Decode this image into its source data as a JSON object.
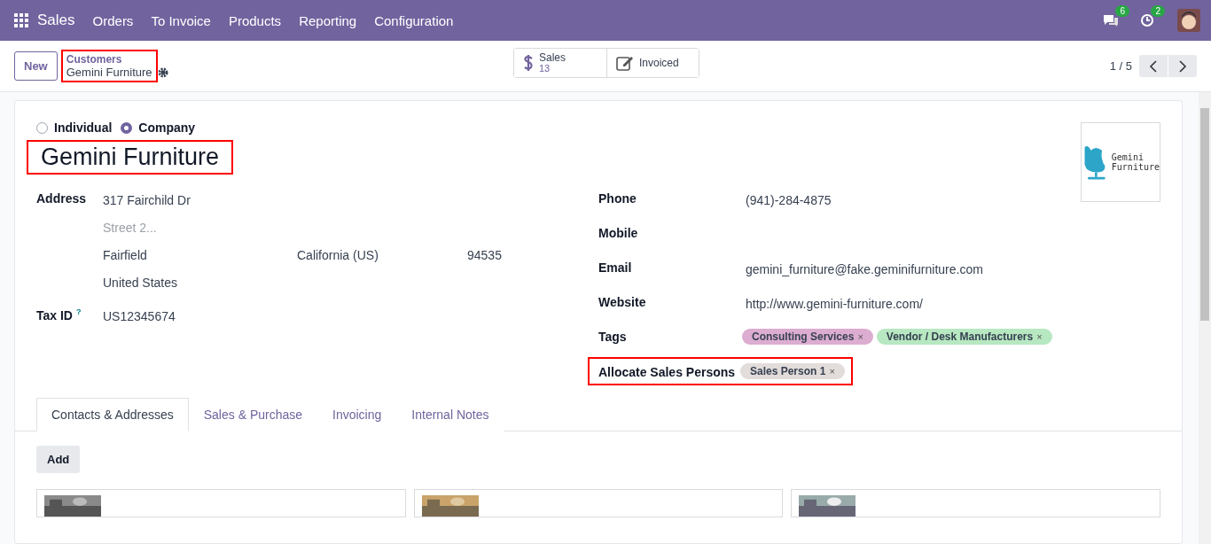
{
  "navbar": {
    "app": "Sales",
    "menu": [
      "Orders",
      "To Invoice",
      "Products",
      "Reporting",
      "Configuration"
    ],
    "messages_badge": "6",
    "activities_badge": "2"
  },
  "control_panel": {
    "new_button": "New",
    "breadcrumb": {
      "parent": "Customers",
      "current": "Gemini Furniture",
      "highlighted": true
    },
    "smart_buttons": [
      {
        "kind": "stat",
        "label": "Sales",
        "value": "13"
      },
      {
        "kind": "plain",
        "label": "Invoiced"
      }
    ],
    "pager": "1 / 5"
  },
  "form": {
    "company_type": [
      {
        "label": "Individual",
        "selected": false
      },
      {
        "label": "Company",
        "selected": true
      }
    ],
    "name": "Gemini Furniture",
    "name_highlighted": true,
    "logo_text": [
      "Gemini",
      "Furniture"
    ],
    "address_label": "Address",
    "street": "317 Fairchild Dr",
    "street2_placeholder": "Street 2...",
    "city": "Fairfield",
    "state": "California (US)",
    "zip": "94535",
    "country": "United States",
    "tax_id_label": "Tax ID",
    "tax_id_help": "?",
    "tax_id": "US12345674",
    "right_fields": [
      {
        "label": "Phone",
        "value": "(941)-284-4875"
      },
      {
        "label": "Mobile"
      },
      {
        "label": "Email",
        "value": "gemini_furniture@fake.geminifurniture.com"
      },
      {
        "label": "Website",
        "value": "http://www.gemini-furniture.com/"
      }
    ],
    "tags_label": "Tags",
    "tags": [
      {
        "label": "Consulting Services",
        "color": "#dcadd1"
      },
      {
        "label": "Vendor / Desk Manufacturers",
        "color": "#b7e8c1"
      }
    ],
    "sales_persons_label": "Allocate Sales Persons",
    "sales_persons_highlighted": true,
    "sales_persons": [
      {
        "label": "Sales Person 1",
        "color": "#e2dcda"
      }
    ],
    "remove_mark": "×",
    "tabs": [
      {
        "label": "Contacts & Addresses",
        "selected": true
      },
      {
        "label": "Sales & Purchase",
        "selected": false
      },
      {
        "label": "Invoicing",
        "selected": false
      },
      {
        "label": "Internal Notes",
        "selected": false
      }
    ],
    "add_button": "Add",
    "contacts": [
      {
        "kind": "picture"
      },
      {
        "kind": "picture"
      },
      {
        "kind": "picture"
      }
    ]
  }
}
